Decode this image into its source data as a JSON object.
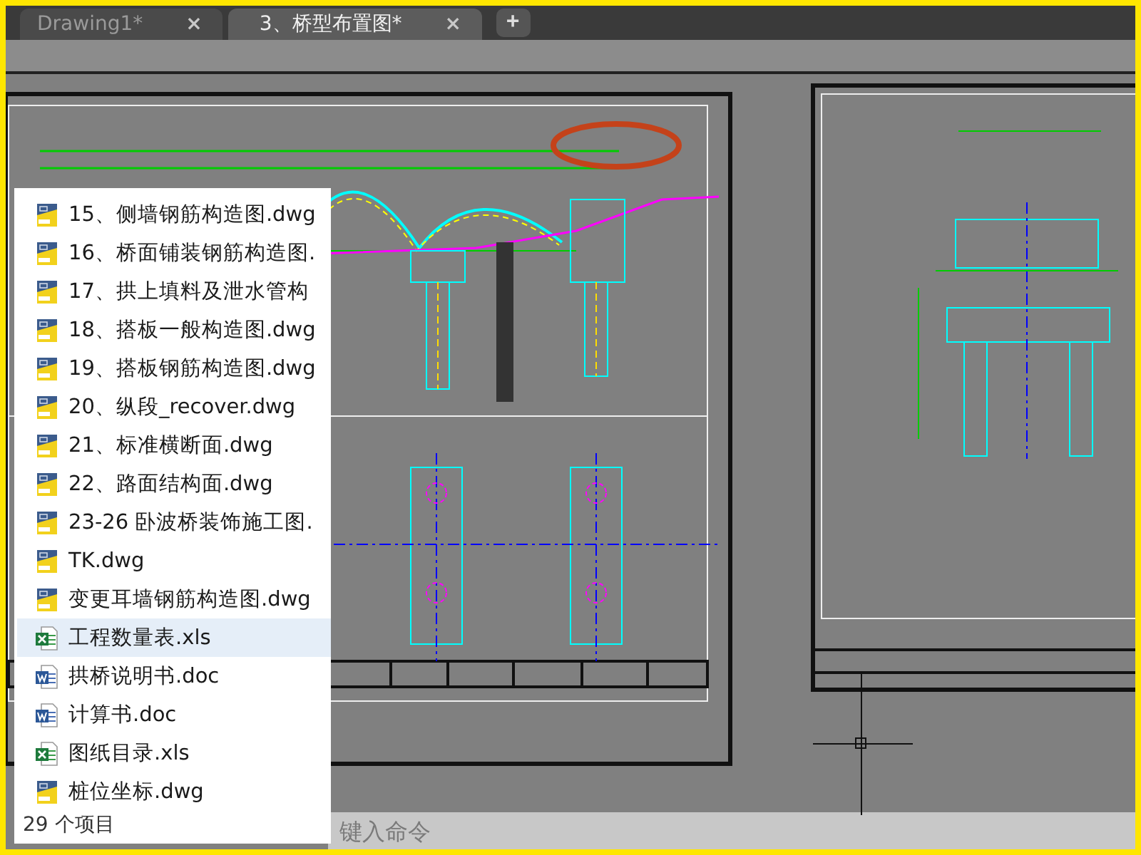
{
  "tabs": [
    {
      "label": "Drawing1*",
      "selected": false,
      "close": "×"
    },
    {
      "label": "3、桥型布置图*",
      "selected": true,
      "close": "×"
    }
  ],
  "new_tab": "+",
  "command_line": {
    "placeholder": "键入命令"
  },
  "file_list": {
    "items": [
      {
        "name": "15、侧墙钢筋构造图.dwg",
        "kind": "dwg",
        "selected": false
      },
      {
        "name": "16、桥面铺装钢筋构造图.",
        "kind": "dwg",
        "selected": false
      },
      {
        "name": "17、拱上填料及泄水管构",
        "kind": "dwg",
        "selected": false
      },
      {
        "name": "18、搭板一般构造图.dwg",
        "kind": "dwg",
        "selected": false
      },
      {
        "name": "19、搭板钢筋构造图.dwg",
        "kind": "dwg",
        "selected": false
      },
      {
        "name": "20、纵段_recover.dwg",
        "kind": "dwg",
        "selected": false
      },
      {
        "name": "21、标准横断面.dwg",
        "kind": "dwg",
        "selected": false
      },
      {
        "name": "22、路面结构面.dwg",
        "kind": "dwg",
        "selected": false
      },
      {
        "name": "23-26 卧波桥装饰施工图.",
        "kind": "dwg",
        "selected": false
      },
      {
        "name": "TK.dwg",
        "kind": "dwg",
        "selected": false
      },
      {
        "name": "变更耳墙钢筋构造图.dwg",
        "kind": "dwg",
        "selected": false
      },
      {
        "name": "工程数量表.xls",
        "kind": "xls",
        "selected": true
      },
      {
        "name": "拱桥说明书.doc",
        "kind": "doc",
        "selected": false
      },
      {
        "name": "计算书.doc",
        "kind": "doc",
        "selected": false
      },
      {
        "name": "图纸目录.xls",
        "kind": "xls",
        "selected": false
      },
      {
        "name": "桩位坐标.dwg",
        "kind": "dwg",
        "selected": false
      }
    ],
    "count": "29 个项目"
  }
}
